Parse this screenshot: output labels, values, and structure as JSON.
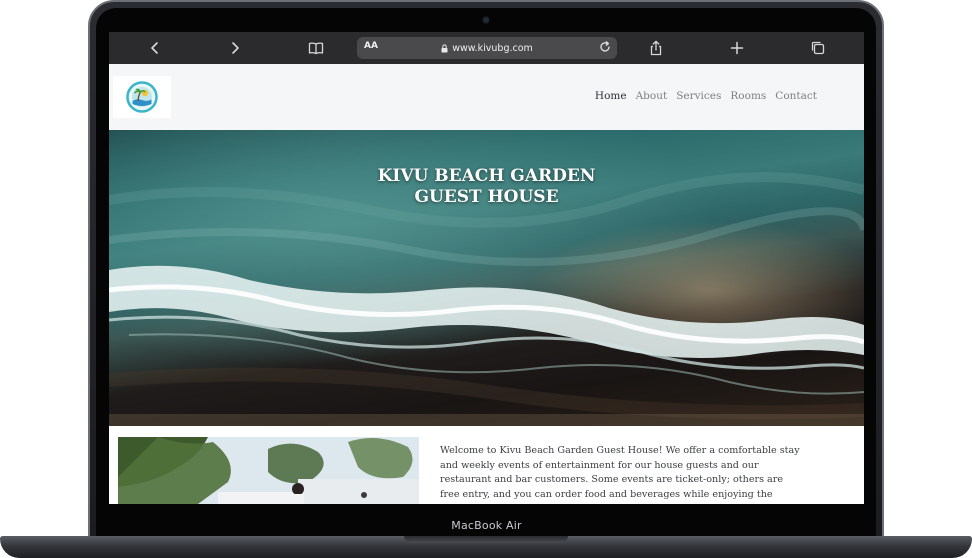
{
  "device": {
    "model_label": "MacBook Air"
  },
  "browser": {
    "text_size_label": "AA",
    "url": "www.kivubg.com"
  },
  "site": {
    "nav": [
      {
        "label": "Home",
        "active": true
      },
      {
        "label": "About",
        "active": false
      },
      {
        "label": "Services",
        "active": false
      },
      {
        "label": "Rooms",
        "active": false
      },
      {
        "label": "Contact",
        "active": false
      }
    ],
    "hero": {
      "title_line1": "KIVU BEACH GARDEN",
      "title_line2": "GUEST HOUSE"
    },
    "intro_text": "Welcome to Kivu Beach Garden Guest House! We offer a comfortable stay and weekly events of entertainment for our house guests and our restaurant and bar customers. Some events are ticket-only; others are free entry, and you can order food and beverages while enjoying the event. Some events have a"
  },
  "colors": {
    "toolbar": "#2b2b2d",
    "header_bg": "#f5f6f8",
    "nav_active": "#2c2f33",
    "nav_inactive": "#7c7f85"
  },
  "icons": {
    "toolbar": [
      "chevron-left-icon",
      "chevron-right-icon",
      "book-icon",
      "lock-icon",
      "reload-icon",
      "share-icon",
      "plus-icon",
      "tabs-icon"
    ]
  }
}
